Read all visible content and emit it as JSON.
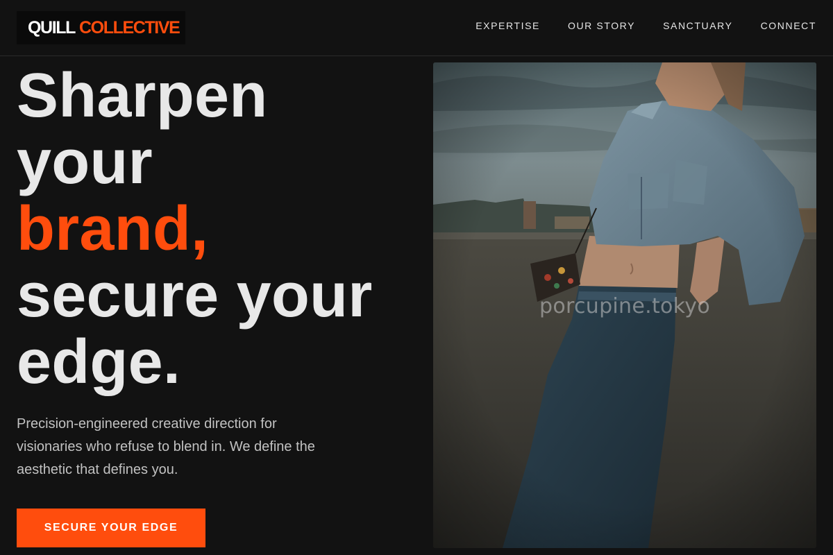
{
  "brand": {
    "name_part1": "QUILL",
    "name_part2": "COLLECTIVE"
  },
  "nav": {
    "items": [
      {
        "label": "EXPERTISE"
      },
      {
        "label": "OUR STORY"
      },
      {
        "label": "SANCTUARY"
      },
      {
        "label": "CONNECT"
      }
    ]
  },
  "hero": {
    "headline": {
      "line1": "Sharpen",
      "line2": "your",
      "line3_accent": "brand,",
      "line4": "secure your",
      "line5": "edge."
    },
    "subtitle": "Precision-engineered creative direction for visionaries who refuse to blend in. We define the aesthetic that defines you.",
    "cta_label": "SECURE YOUR EDGE"
  },
  "photo": {
    "watermark": "porcupine.tokyo",
    "alt": "Model in cropped denim jacket and jeans leaning against a concrete wall"
  },
  "colors": {
    "accent": "#ff4d0d",
    "background": "#121212",
    "text": "#e8e8e8"
  }
}
